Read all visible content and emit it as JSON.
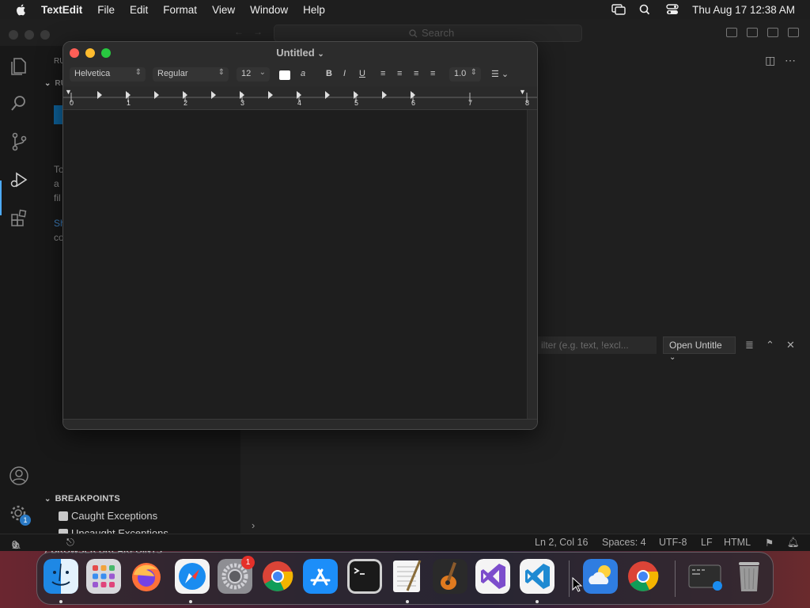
{
  "menubar": {
    "app_name": "TextEdit",
    "items": [
      "File",
      "Edit",
      "Format",
      "View",
      "Window",
      "Help"
    ],
    "clock": "Thu Aug 17  12:38 AM",
    "status_icons": [
      "screen-mirroring-icon",
      "spotlight-icon",
      "control-center-icon"
    ]
  },
  "vscode": {
    "search_placeholder": "Search",
    "sidebar_fragments": [
      "RU",
      "RU",
      "To",
      "a",
      "fil",
      "Sh",
      "co"
    ],
    "breakpoints": {
      "header": "BREAKPOINTS",
      "items": [
        "Caught Exceptions",
        "Uncaught Exceptions"
      ],
      "browser_header": "BROWSER BREAKPOINTS"
    },
    "settings_badge": "1",
    "panel": {
      "filter_placeholder": "ilter (e.g. text, !excl...",
      "output_channel": "Open Untitle"
    },
    "statusbar": {
      "errors": "0",
      "warnings": "0",
      "position": "Ln 2, Col 16",
      "spaces": "Spaces: 4",
      "encoding": "UTF-8",
      "eol": "LF",
      "language": "HTML"
    }
  },
  "textedit": {
    "title": "Untitled",
    "font_family": "Helvetica",
    "font_style": "Regular",
    "font_size": "12",
    "line_spacing": "1.0",
    "bold": "B",
    "italic": "I",
    "underline": "U",
    "ruler_numbers": [
      "0",
      "1",
      "2",
      "3",
      "4",
      "5",
      "6",
      "7",
      "8"
    ]
  },
  "dock": {
    "apps": [
      "Finder",
      "Launchpad",
      "Firefox",
      "Safari",
      "System Settings",
      "Google Chrome",
      "App Store",
      "Terminal",
      "TextEdit",
      "GarageBand",
      "Visual Studio",
      "Visual Studio Code",
      "Weather",
      "Google Chrome"
    ],
    "settings_badge": "1"
  },
  "colors": {
    "close": "#ff5f57",
    "minimize": "#febc2e",
    "zoom": "#28c840",
    "accent": "#4daafc"
  }
}
